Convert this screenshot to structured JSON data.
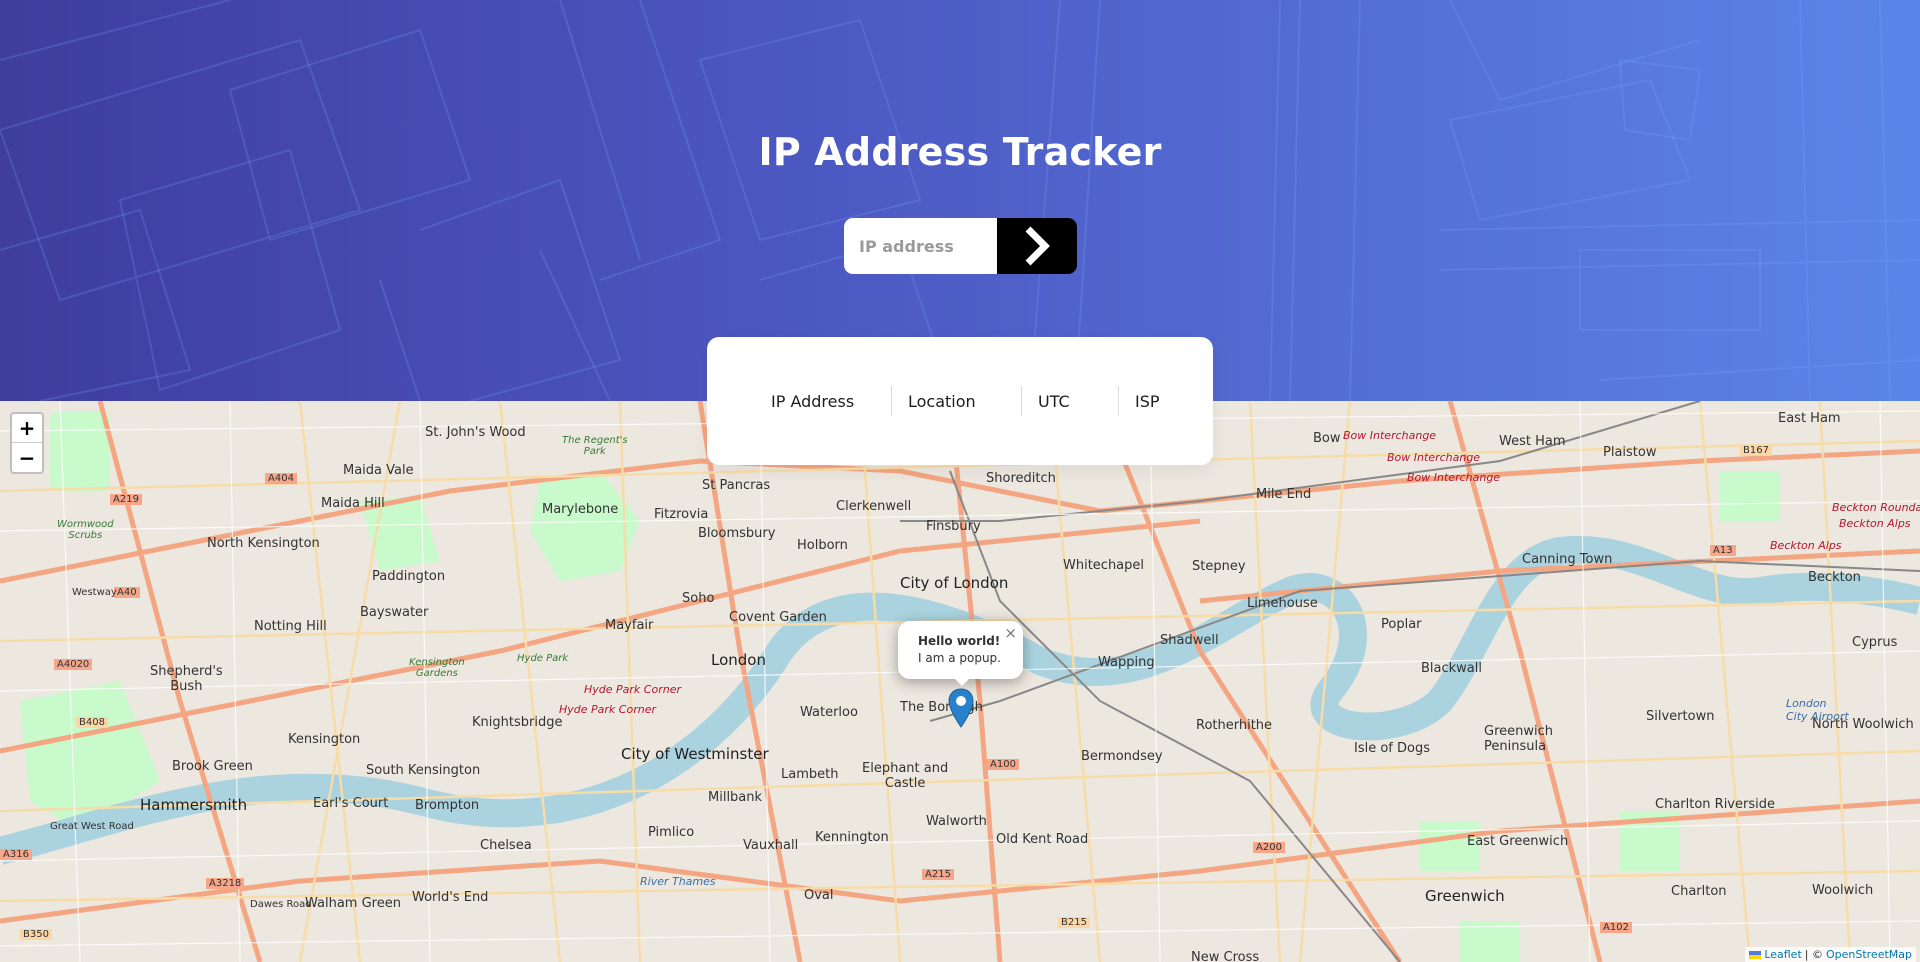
{
  "header": {
    "title": "IP Address Tracker",
    "search": {
      "placeholder": "IP address",
      "value": ""
    },
    "submit_icon": "chevron-right-icon"
  },
  "info_card": {
    "fields": [
      {
        "label": "IP Address"
      },
      {
        "label": "Location"
      },
      {
        "label": "UTC"
      },
      {
        "label": "ISP"
      }
    ]
  },
  "map": {
    "zoom_in": "+",
    "zoom_out": "−",
    "popup": {
      "title": "Hello world!",
      "body": "I am a popup.",
      "close": "×"
    },
    "attribution": {
      "leaflet": "Leaflet",
      "separator": "| ©",
      "osm": "OpenStreetMap"
    },
    "labels": {
      "st_johns_wood": "St. John's Wood",
      "maida_vale": "Maida Vale",
      "maida_hill": "Maida Hill",
      "north_kensington": "North Kensington",
      "paddington": "Paddington",
      "bayswater": "Bayswater",
      "notting_hill": "Notting Hill",
      "shepherds_bush": "Shepherd's\nBush",
      "kensington": "Kensington",
      "knightsbridge": "Knightsbridge",
      "south_kensington": "South Kensington",
      "brook_green": "Brook Green",
      "hammersmith": "Hammersmith",
      "earls_court": "Earl's Court",
      "brompton": "Brompton",
      "chelsea": "Chelsea",
      "walham_green": "Walham Green",
      "worlds_end": "World's End",
      "marylebone": "Marylebone",
      "fitzrovia": "Fitzrovia",
      "bloomsbury": "Bloomsbury",
      "st_pancras": "St Pancras",
      "holborn": "Holborn",
      "clerkenwell": "Clerkenwell",
      "finsbury": "Finsbury",
      "shoreditch": "Shoreditch",
      "soho": "Soho",
      "mayfair": "Mayfair",
      "covent_garden": "Covent Garden",
      "london": "London",
      "city_of_london": "City of London",
      "whitechapel": "Whitechapel",
      "stepney": "Stepney",
      "mile_end": "Mile End",
      "bow": "Bow",
      "west_ham": "West Ham",
      "plaistow": "Plaistow",
      "east_ham": "East Ham",
      "canning_town": "Canning Town",
      "beckton": "Beckton",
      "cyprus": "Cyprus",
      "limehouse": "Limehouse",
      "poplar": "Poplar",
      "shadwell": "Shadwell",
      "wapping": "Wapping",
      "blackwall": "Blackwall",
      "rotherhithe": "Rotherhithe",
      "isle_of_dogs": "Isle of Dogs",
      "greenwich_peninsula": "Greenwich\nPeninsula",
      "silvertown": "Silvertown",
      "north_woolwich": "North Woolwich",
      "charlton_riverside": "Charlton Riverside",
      "east_greenwich": "East Greenwich",
      "charlton": "Charlton",
      "woolwich": "Woolwich",
      "greenwich": "Greenwich",
      "bermondsey": "Bermondsey",
      "the_borough": "The Borough",
      "waterloo": "Waterloo",
      "lambeth": "Lambeth",
      "elephant_and_castle": "Elephant and\nCastle",
      "city_of_westminster": "City of Westminster",
      "millbank": "Millbank",
      "pimlico": "Pimlico",
      "vauxhall": "Vauxhall",
      "kennington": "Kennington",
      "walworth": "Walworth",
      "old_kent_road": "Old Kent Road",
      "oval": "Oval",
      "new_cross": "New Cross",
      "hyde_park": "Hyde Park",
      "kensington_gardens": "Kensington\nGardens",
      "the_regents_park": "The Regent's\nPark",
      "wormwood_scrubs": "Wormwood\nScrubs",
      "hyde_park_corner": "Hyde Park Corner",
      "bow_interchange": "Bow Interchange",
      "beckton_roundabout": "Beckton Roundabo",
      "beckton_alps": "Beckton Alps",
      "london_city_airport": "London\nCity Airport",
      "a404": "A404",
      "a219": "A219",
      "a40": "A40",
      "a4020": "A4020",
      "b408": "B408",
      "a3218": "A3218",
      "a316": "A316",
      "b350": "B350",
      "a100": "A100",
      "a215": "A215",
      "b215": "B215",
      "a200": "A200",
      "a102": "A102",
      "a13": "A13",
      "b167": "B167",
      "westway": "Westway",
      "dawes_road": "Dawes Road",
      "great_west_road": "Great West Road",
      "river_thames": "River Thames"
    }
  },
  "colors": {
    "header_start": "#3f3d9e",
    "header_end": "#5b85e8",
    "button_bg": "#000000",
    "card_bg": "#ffffff",
    "marker": "#2a81cb",
    "river": "#aad3df",
    "park": "#c8facc",
    "road_major": "#f7a68a",
    "road_secondary": "#fcd6a4"
  }
}
